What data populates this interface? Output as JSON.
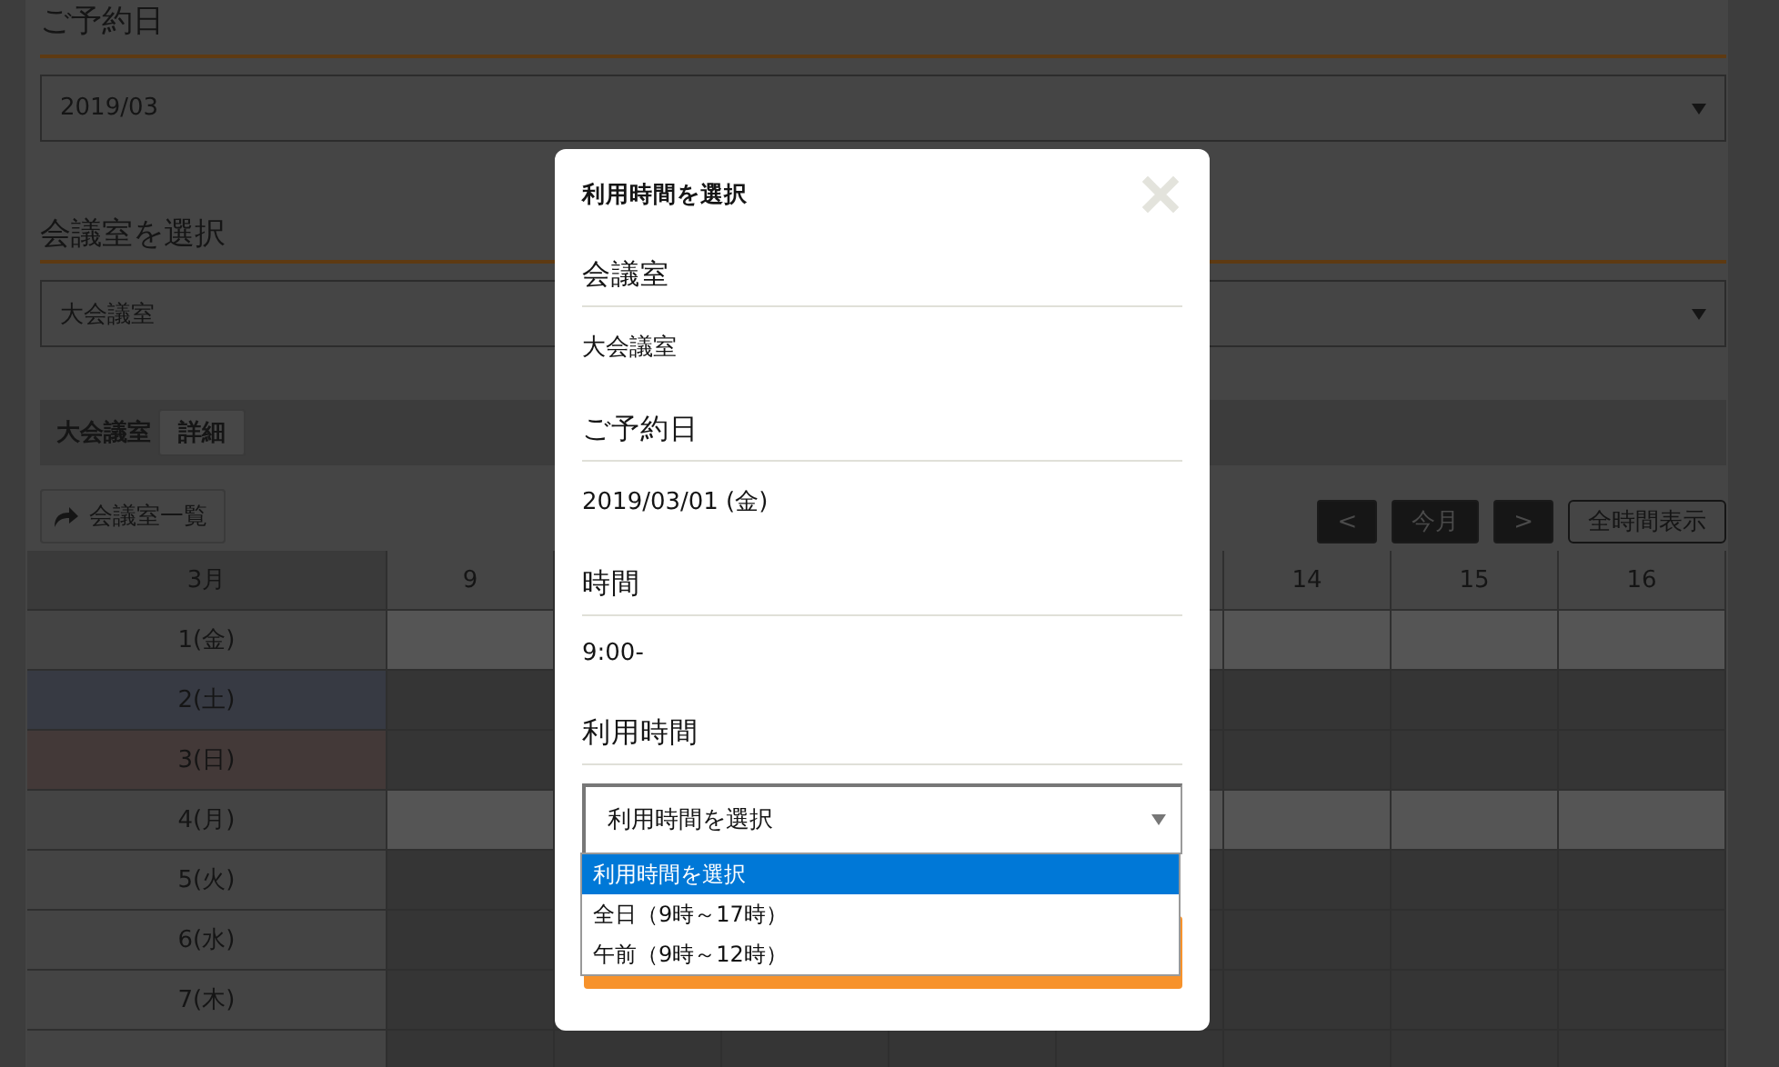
{
  "date_section": {
    "heading": "ご予約日",
    "select_value": "2019/03"
  },
  "room_section": {
    "heading": "会議室を選択",
    "select_value": "大会議室"
  },
  "room_bar": {
    "name": "大会議室",
    "detail_button": "詳細"
  },
  "room_list_button": "会議室一覧",
  "calendar_nav": [
    {
      "label": "<",
      "kind": "filled"
    },
    {
      "label": "今月",
      "kind": "filled"
    },
    {
      "label": ">",
      "kind": "filled"
    },
    {
      "label": "全時間表示",
      "kind": "outline"
    }
  ],
  "table": {
    "columns": [
      "3月",
      "9",
      "",
      "",
      "",
      "",
      "14",
      "15",
      "16"
    ],
    "rows": [
      {
        "label": "1(金)",
        "color": "#444444",
        "available": true
      },
      {
        "label": "2(土)",
        "color": "#373a43",
        "available": false
      },
      {
        "label": "3(日)",
        "color": "#433938",
        "available": false
      },
      {
        "label": "4(月)",
        "color": "#444444",
        "available": true
      },
      {
        "label": "5(火)",
        "color": "#444444",
        "available": false
      },
      {
        "label": "6(水)",
        "color": "#444444",
        "available": false
      },
      {
        "label": "7(木)",
        "color": "#444444",
        "available": false
      },
      {
        "label": "",
        "color": "#444444",
        "available": false
      }
    ]
  },
  "modal": {
    "title": "利用時間を選択",
    "fields": [
      {
        "label": "会議室",
        "value": "大会議室"
      },
      {
        "label": "ご予約日",
        "value": "2019/03/01 (金)"
      },
      {
        "label": "時間",
        "value": "9:00-"
      }
    ],
    "select_label": "利用時間",
    "select_value": "利用時間を選択",
    "options": [
      {
        "label": "利用時間を選択",
        "selected": true
      },
      {
        "label": "全日（9時～17時）",
        "selected": false
      },
      {
        "label": "午前（9時～12時）",
        "selected": false
      }
    ]
  }
}
